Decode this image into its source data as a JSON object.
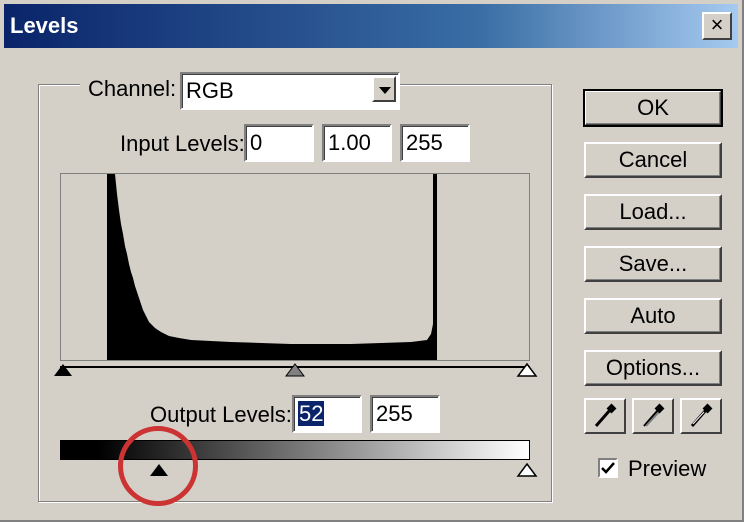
{
  "window": {
    "title": "Levels",
    "close_label": "×"
  },
  "channel": {
    "label": "Channel:",
    "value": "RGB"
  },
  "input_levels": {
    "label": "Input Levels:",
    "black": "0",
    "gamma": "1.00",
    "white": "255"
  },
  "output_levels": {
    "label": "Output Levels:",
    "black": "52",
    "white": "255"
  },
  "buttons": {
    "ok": "OK",
    "cancel": "Cancel",
    "load": "Load...",
    "save": "Save...",
    "auto": "Auto",
    "options": "Options..."
  },
  "preview": {
    "label": "Preview",
    "checked": true
  },
  "icons": [
    "eyedropper-black-icon",
    "eyedropper-gray-icon",
    "eyedropper-white-icon"
  ],
  "annotation": {
    "color": "#cc3333"
  }
}
